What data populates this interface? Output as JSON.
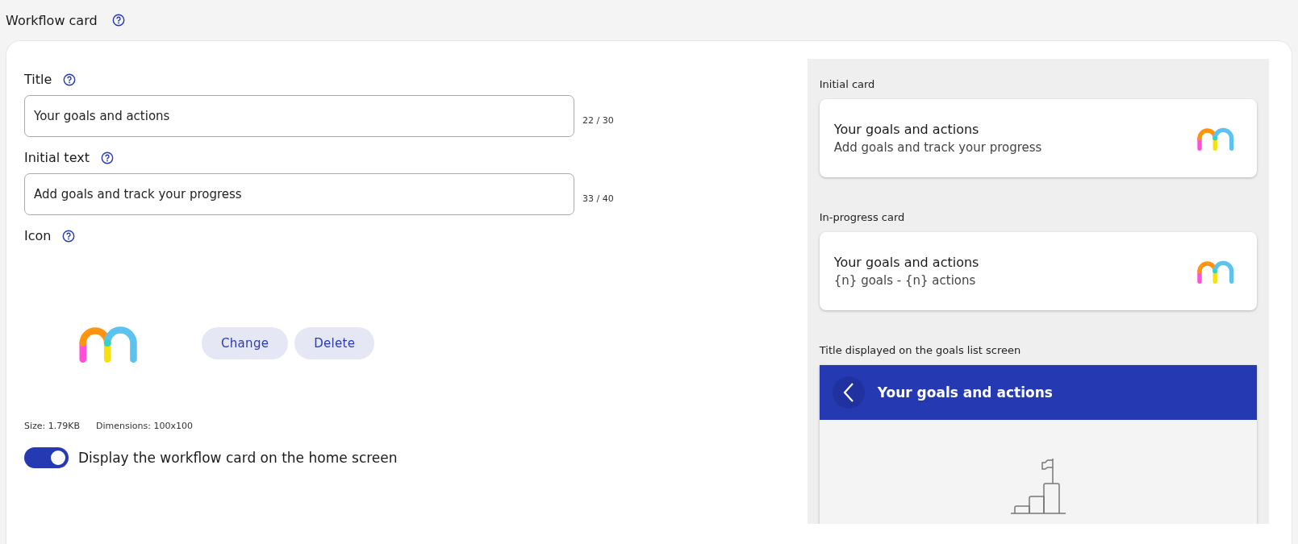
{
  "header": {
    "title": "Workflow card"
  },
  "fields": [
    {
      "label": "Title",
      "value": "Your goals and actions",
      "counter": "22 / 30"
    },
    {
      "label": "Initial text",
      "value": "Add goals and track your progress",
      "counter": "33 / 40"
    }
  ],
  "icon": {
    "label": "Icon",
    "buttons": [
      "Change",
      "Delete"
    ],
    "size": "Size: 1.79KB",
    "dimensions": "Dimensions: 100x100"
  },
  "display_toggle": {
    "label": "Display the workflow card on the home screen",
    "on": true
  },
  "preview": {
    "cards": [
      {
        "caption": "Initial card",
        "title": "Your goals and actions",
        "subtitle": "Add goals and track your progress"
      },
      {
        "caption": "In-progress card",
        "title": "Your goals and actions",
        "subtitle": "{n} goals - {n} actions"
      }
    ],
    "goals_list": {
      "caption": "Title displayed on the goals list screen",
      "title": "Your goals and actions"
    }
  }
}
